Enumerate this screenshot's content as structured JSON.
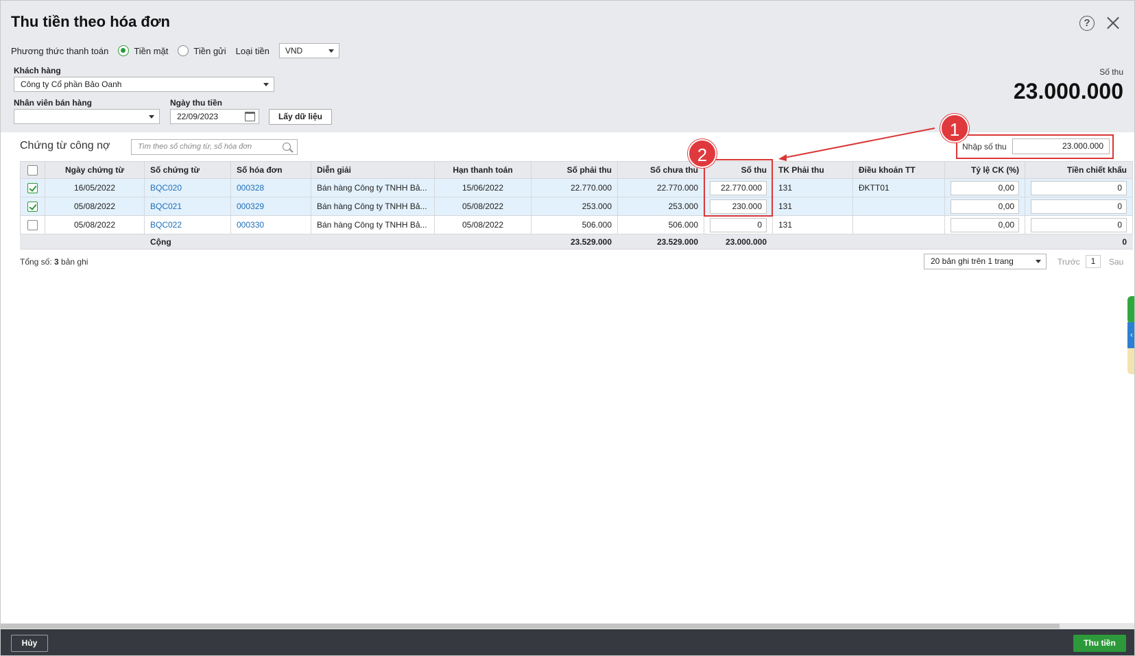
{
  "dialog": {
    "title": "Thu tiền theo hóa đơn"
  },
  "payment": {
    "method_label": "Phương thức thanh toán",
    "options": [
      "Tiền mặt",
      "Tiền gửi"
    ],
    "selected": "Tiền mặt",
    "currency_label": "Loại tiền",
    "currency_value": "VND"
  },
  "filters": {
    "customer_label": "Khách hàng",
    "customer_value": "Công ty Cổ phần Bảo Oanh",
    "salesperson_label": "Nhân viên bán hàng",
    "salesperson_value": "",
    "date_label": "Ngày thu tiền",
    "date_value": "22/09/2023",
    "fetch_button": "Lấy dữ liệu"
  },
  "summary": {
    "label": "Số thu",
    "value": "23.000.000"
  },
  "grid": {
    "title": "Chứng từ công nợ",
    "search_placeholder": "Tìm theo số chứng từ, số hóa đơn",
    "amount_input_label": "Nhập số thu",
    "amount_input_value": "23.000.000",
    "columns": [
      "",
      "Ngày chứng từ",
      "Số chứng từ",
      "Số hóa đơn",
      "Diễn giải",
      "Hạn thanh toán",
      "Số phải thu",
      "Số chưa thu",
      "Số thu",
      "TK Phải thu",
      "Điều khoản TT",
      "Tỷ lệ CK (%)",
      "Tiền chiết khấu"
    ],
    "rows": [
      {
        "checked": true,
        "date": "16/05/2022",
        "voucher": "BQC020",
        "invoice": "000328",
        "desc": "Bán hàng Công ty TNHH Bả...",
        "due": "15/06/2022",
        "receivable": "22.770.000",
        "unpaid": "22.770.000",
        "amount": "22.770.000",
        "account": "131",
        "terms": "ĐKTT01",
        "rate": "0,00",
        "discount": "0"
      },
      {
        "checked": true,
        "date": "05/08/2022",
        "voucher": "BQC021",
        "invoice": "000329",
        "desc": "Bán hàng Công ty TNHH Bả...",
        "due": "05/08/2022",
        "receivable": "253.000",
        "unpaid": "253.000",
        "amount": "230.000",
        "account": "131",
        "terms": "",
        "rate": "0,00",
        "discount": "0"
      },
      {
        "checked": false,
        "date": "05/08/2022",
        "voucher": "BQC022",
        "invoice": "000330",
        "desc": "Bán hàng Công ty TNHH Bả...",
        "due": "05/08/2022",
        "receivable": "506.000",
        "unpaid": "506.000",
        "amount": "0",
        "account": "131",
        "terms": "",
        "rate": "0,00",
        "discount": "0"
      }
    ],
    "total": {
      "label": "Cộng",
      "receivable": "23.529.000",
      "unpaid": "23.529.000",
      "amount": "23.000.000",
      "discount": "0"
    }
  },
  "footer": {
    "count_prefix": "Tổng số: ",
    "count": "3",
    "count_suffix": " bản ghi",
    "page_size": "20 bản ghi trên 1 trang",
    "prev": "Trước",
    "page": "1",
    "next": "Sau"
  },
  "annotations": {
    "badge1": "1",
    "badge2": "2",
    "color": "#d93636"
  },
  "actions": {
    "cancel": "Hủy",
    "submit": "Thu tiền"
  },
  "colors": {
    "accent_green": "#2c9a3a",
    "link_blue": "#1e6fb8",
    "bottom_bar": "#36393f"
  }
}
